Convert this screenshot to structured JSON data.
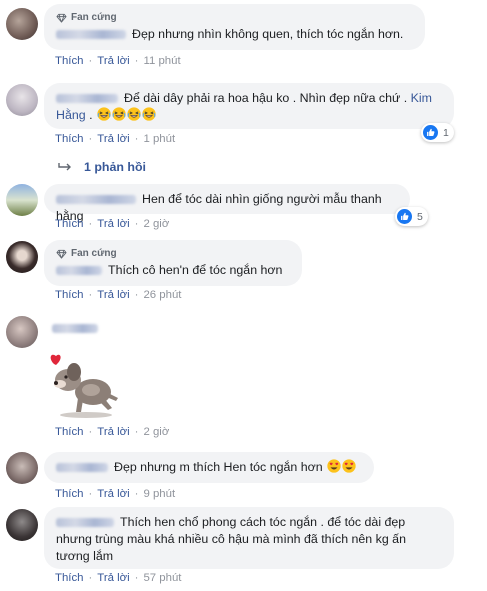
{
  "labels": {
    "like": "Thích",
    "reply": "Trả lời",
    "fan_badge": "Fan cứng",
    "separator": "·"
  },
  "comments": [
    {
      "text": "Đẹp nhưng nhìn không quen, thích tóc ngắn hơn.",
      "time": "11 phút"
    },
    {
      "text_line1": "Để dài dây phải ra hoa hậu ko . Nhìn đẹp nữa chứ .",
      "mention_part1": "Kim",
      "mention_part2": "Hằng",
      "text_after_mention": ".",
      "time": "1 phút",
      "reaction_count": "1"
    },
    {
      "text": "Hen để tóc dài nhìn giống người mẫu thanh hằng",
      "time": "2 giờ",
      "reaction_count": "5"
    },
    {
      "text": "Thích cô hen'n để tóc ngắn hơn",
      "time": "26 phút"
    },
    {
      "sticker": "dog-heart-sticker",
      "time": "2 giờ"
    },
    {
      "text": "Đẹp nhưng m thích Hen tóc ngắn hơn",
      "time": "9 phút"
    },
    {
      "text_line1": "Thích hen chổ phong cách tóc ngắn . để tóc dài đẹp",
      "text_line2": "nhưng trùng màu khá nhiều cô hậu mà mình đã thích nên kg ấn",
      "text_line3": "tương lắm",
      "time": "57 phút"
    }
  ],
  "replies_link": "1 phản hồi",
  "colors": {
    "link": "#385898",
    "bubble": "#f2f3f5",
    "like_blue": "#1877f2",
    "meta_gray": "#90949c"
  }
}
